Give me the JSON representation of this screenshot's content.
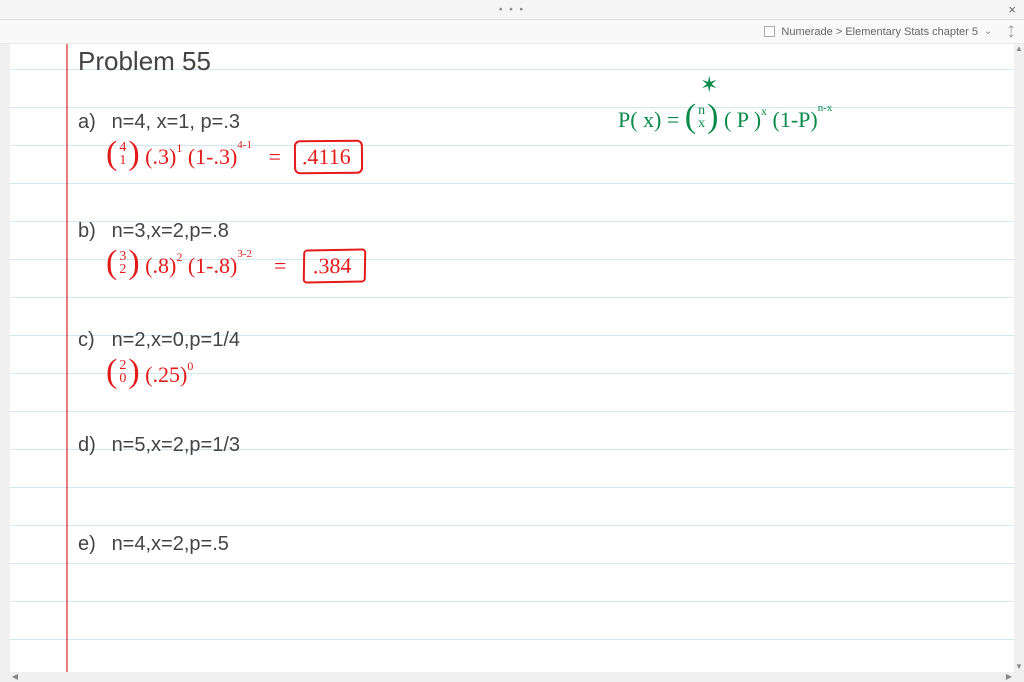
{
  "titlebar": {
    "dots": "• • •",
    "close": "×"
  },
  "chrome": {
    "ref_text": "Numerade > Elementary Stats chapter 5",
    "chevron": "⌄",
    "expand": "⤢"
  },
  "page": {
    "title": "Problem 55",
    "formula": {
      "star": "✶",
      "px": "P( x) =",
      "n": "n",
      "x": "x",
      "p": "( P )",
      "exp_x": "x",
      "q": "(1-P)",
      "exp_nx": "n-x"
    },
    "items": {
      "a": {
        "label": "a)",
        "typed": "n=4, x=1, p=.3",
        "bn_top": "4",
        "bn_bot": "1",
        "t1": "(.3)",
        "e1": "1",
        "t2": "(1-.3)",
        "e2": "4-1",
        "eq": "=",
        "ans": ".4116"
      },
      "b": {
        "label": "b)",
        "typed": "n=3,x=2,p=.8",
        "bn_top": "3",
        "bn_bot": "2",
        "t1": "(.8)",
        "e1": "2",
        "t2": "(1-.8)",
        "e2": "3-2",
        "eq": "=",
        "ans": ".384"
      },
      "c": {
        "label": "c)",
        "typed": "n=2,x=0,p=1/4",
        "bn_top": "2",
        "bn_bot": "0",
        "t1": "(.25)",
        "e1": "0"
      },
      "d": {
        "label": "d)",
        "typed": "n=5,x=2,p=1/3"
      },
      "e": {
        "label": "e)",
        "typed": "n=4,x=2,p=.5"
      }
    }
  }
}
